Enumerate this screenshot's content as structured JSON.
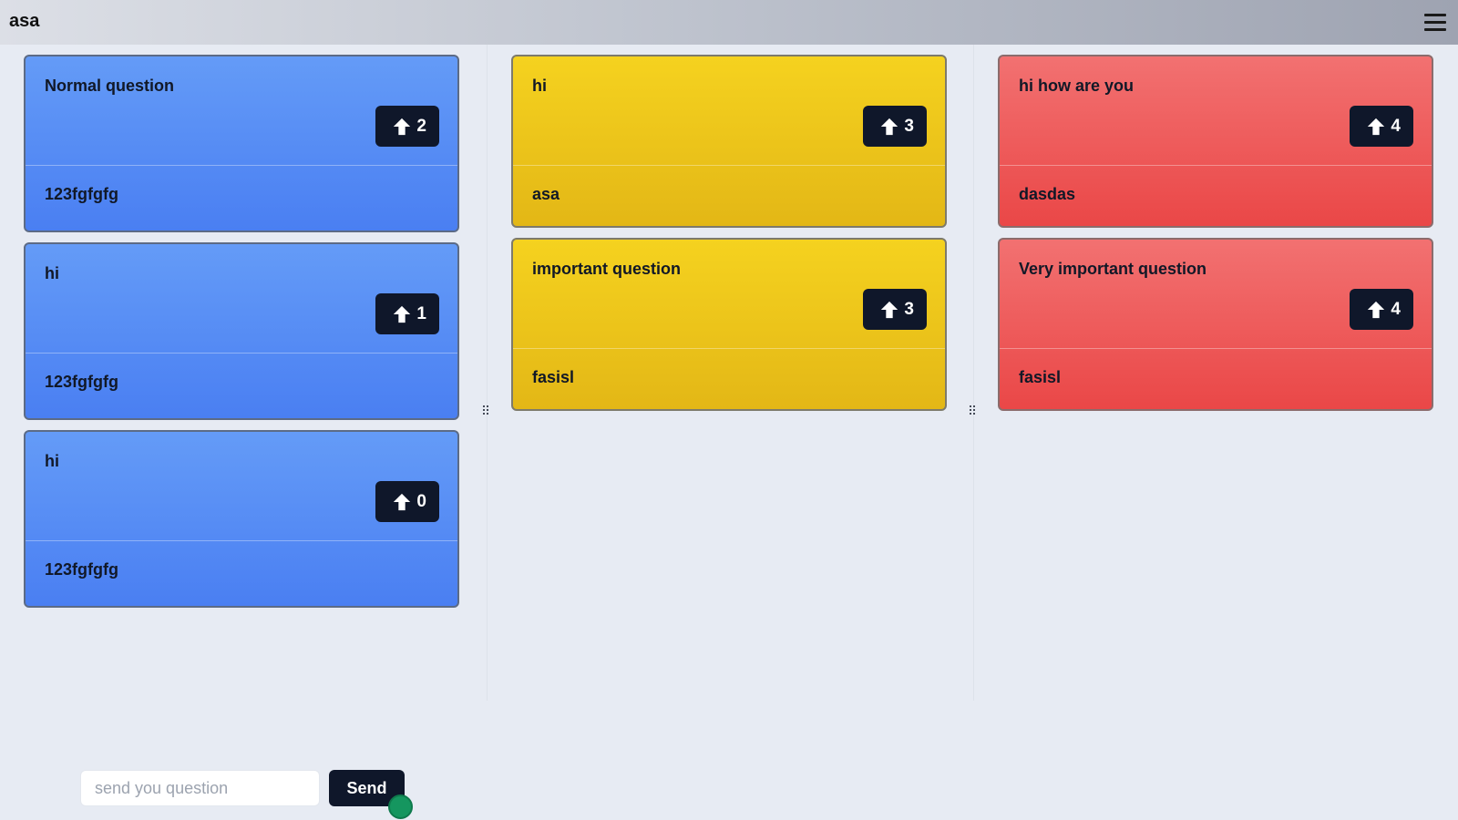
{
  "app": {
    "title": "asa"
  },
  "colors": {
    "blue": "#5b8df5",
    "yellow": "#ecc41b",
    "red": "#ee5c5c",
    "vote_button": "#0f172a",
    "status_dot": "#15965f"
  },
  "columns": [
    {
      "color": "blue",
      "cards": [
        {
          "question": "Normal question",
          "votes": "2",
          "author": "123fgfgfg"
        },
        {
          "question": "hi",
          "votes": "1",
          "author": "123fgfgfg"
        },
        {
          "question": "hi",
          "votes": "0",
          "author": "123fgfgfg"
        }
      ]
    },
    {
      "color": "yellow",
      "cards": [
        {
          "question": "hi",
          "votes": "3",
          "author": "asa"
        },
        {
          "question": "important question",
          "votes": "3",
          "author": "fasisl"
        }
      ]
    },
    {
      "color": "red",
      "cards": [
        {
          "question": "hi how are you",
          "votes": "4",
          "author": "dasdas"
        },
        {
          "question": "Very important question",
          "votes": "4",
          "author": "fasisl"
        }
      ]
    }
  ],
  "composer": {
    "placeholder": "send you question",
    "value": "",
    "send_label": "Send"
  },
  "icons": {
    "menu": "hamburger-menu-icon",
    "vote": "arrow-up-icon",
    "resize": "grip-icon"
  }
}
